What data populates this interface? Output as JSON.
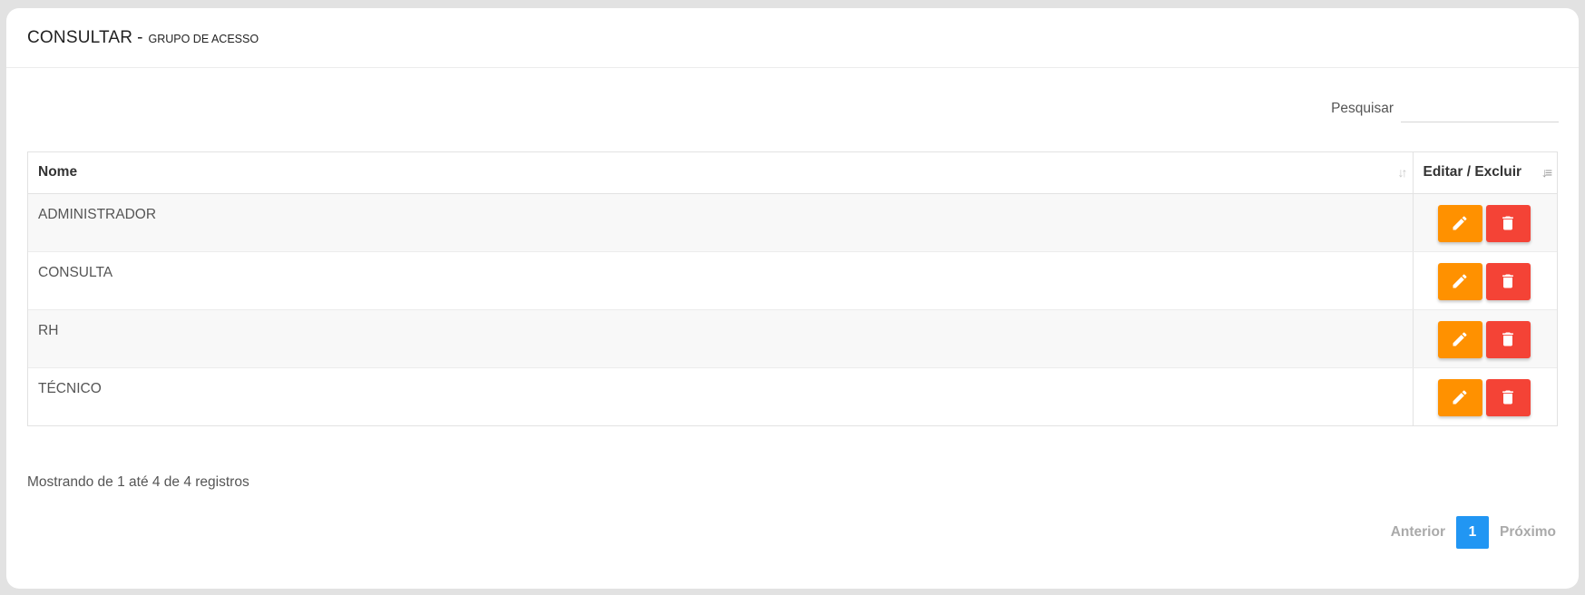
{
  "header": {
    "title": "CONSULTAR",
    "separator": "-",
    "subtitle": "GRUPO DE ACESSO"
  },
  "search": {
    "label": "Pesquisar",
    "value": "",
    "placeholder": ""
  },
  "table": {
    "columns": [
      "Nome",
      "Editar / Excluir"
    ],
    "rows": [
      {
        "name": "ADMINISTRADOR"
      },
      {
        "name": "CONSULTA"
      },
      {
        "name": "RH"
      },
      {
        "name": "TÉCNICO"
      }
    ]
  },
  "info": {
    "text": "Mostrando de 1 até 4 de 4 registros"
  },
  "pagination": {
    "previous": "Anterior",
    "current": "1",
    "next": "Próximo"
  },
  "colors": {
    "edit_button": "#ff9100",
    "delete_button": "#f44336",
    "current_page": "#2196f3"
  },
  "icons": {
    "edit": "pencil-icon",
    "delete": "trash-icon",
    "sort_name": "sort-both-icon",
    "sort_actions": "sort-asc-icon"
  }
}
